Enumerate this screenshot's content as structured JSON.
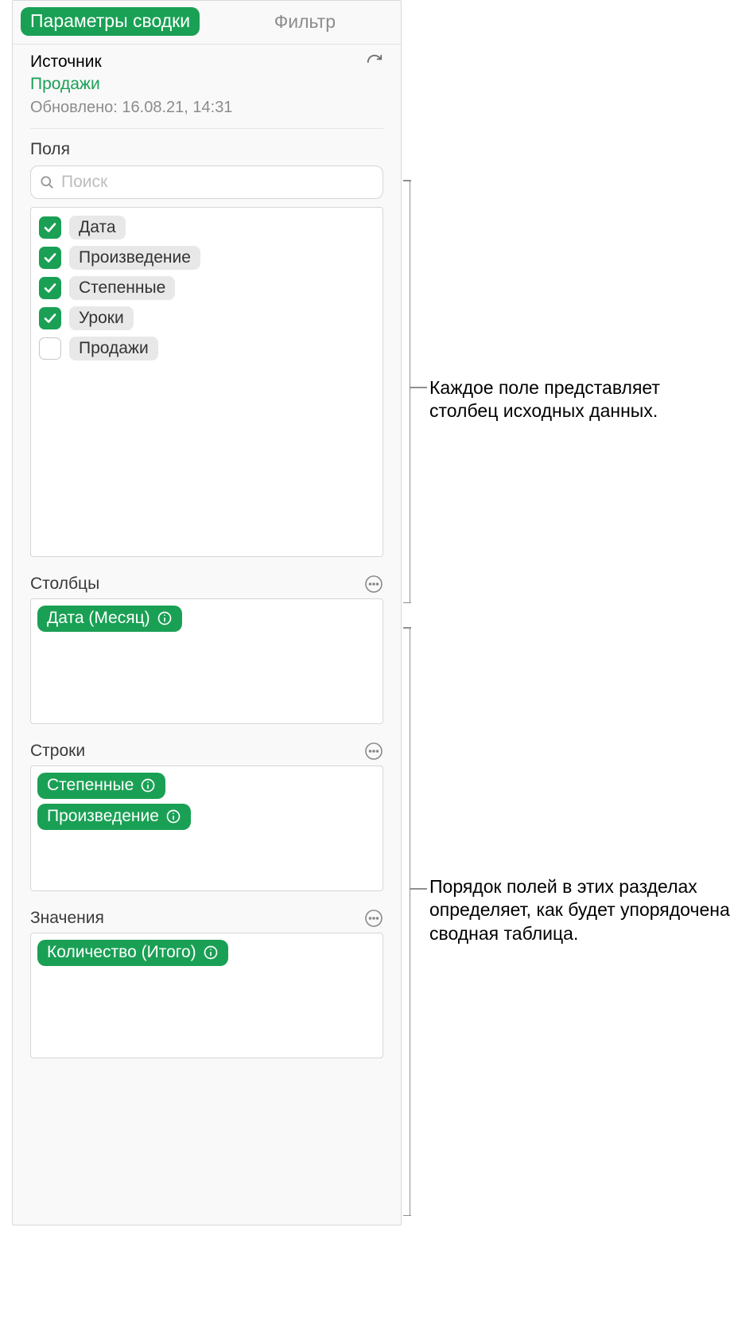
{
  "tabs": {
    "summary": "Параметры сводки",
    "filter": "Фильтр"
  },
  "source": {
    "label": "Источник",
    "name": "Продажи",
    "updated": "Обновлено: 16.08.21, 14:31"
  },
  "fields": {
    "label": "Поля",
    "search_placeholder": "Поиск",
    "items": [
      {
        "label": "Дата",
        "checked": true
      },
      {
        "label": "Произведение",
        "checked": true
      },
      {
        "label": "Степенные",
        "checked": true
      },
      {
        "label": "Уроки",
        "checked": true
      },
      {
        "label": "Продажи",
        "checked": false
      }
    ]
  },
  "zones": {
    "columns": {
      "label": "Столбцы",
      "items": [
        "Дата (Месяц)"
      ]
    },
    "rows": {
      "label": "Строки",
      "items": [
        "Степенные",
        "Произведение"
      ]
    },
    "values": {
      "label": "Значения",
      "items": [
        "Количество (Итого)"
      ]
    }
  },
  "callouts": {
    "fields": "Каждое поле представляет столбец исходных данных.",
    "zones": "Порядок полей в этих разделах определяет, как будет упорядочена сводная таблица."
  }
}
